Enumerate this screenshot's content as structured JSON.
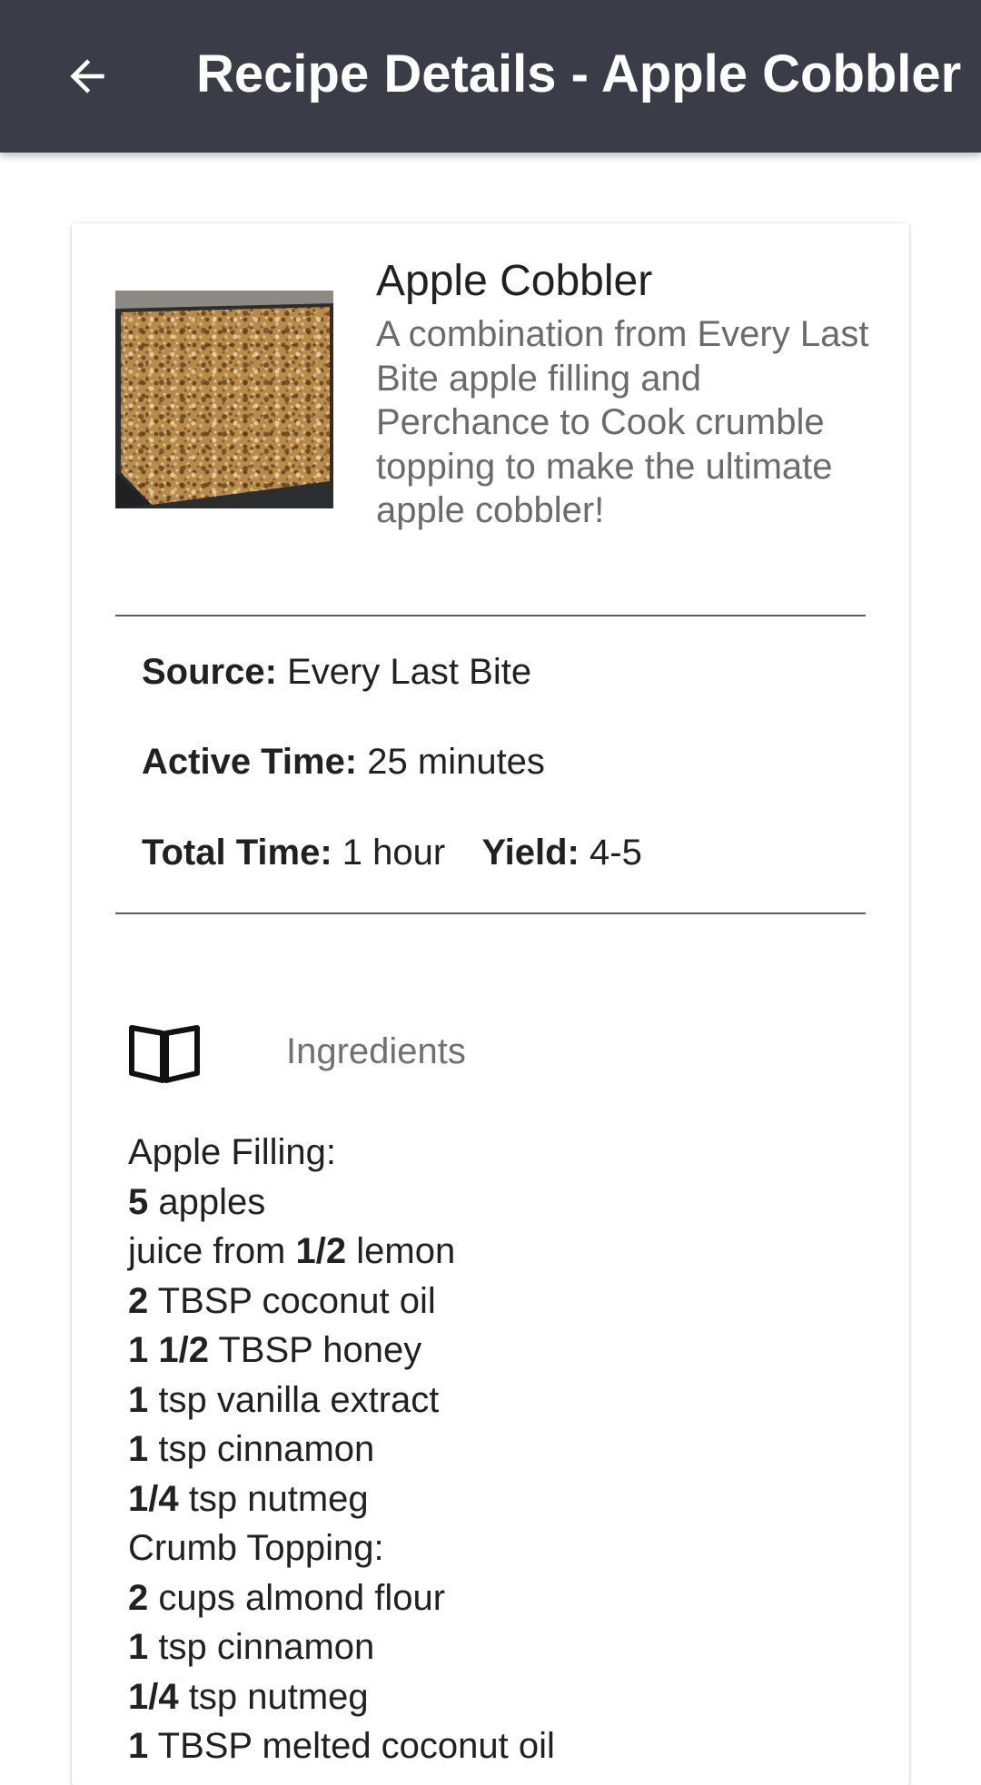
{
  "appbar": {
    "title": "Recipe Details - Apple Cobbler",
    "back_icon": "arrow-left-icon"
  },
  "recipe": {
    "name": "Apple Cobbler",
    "description": "A combination from Every Last Bite apple filling and Perchance to Cook crumble topping to make the ultimate apple cobbler!",
    "image_icon": "apple-cobbler-photo"
  },
  "meta": {
    "source_label": "Source:",
    "source_value": "Every Last Bite",
    "active_label": "Active Time:",
    "active_value": "25 minutes",
    "total_label": "Total Time:",
    "total_value": "1 hour",
    "yield_label": "Yield:",
    "yield_value": "4-5"
  },
  "ingredients_section": {
    "label": "Ingredients",
    "icon": "open-book-icon"
  },
  "ingredients": [
    {
      "qty": "",
      "text": "Apple Filling:"
    },
    {
      "qty": "5",
      "text": "apples"
    },
    {
      "prefix": "juice from",
      "qty": "1/2",
      "text": "lemon"
    },
    {
      "qty": "2",
      "text": "TBSP coconut oil"
    },
    {
      "qty": "1 1/2",
      "text": "TBSP honey"
    },
    {
      "qty": "1",
      "text": "tsp vanilla extract"
    },
    {
      "qty": "1",
      "text": "tsp cinnamon"
    },
    {
      "qty": "1/4",
      "text": "tsp nutmeg"
    },
    {
      "qty": "",
      "text": "Crumb Topping:"
    },
    {
      "qty": "2",
      "text": "cups almond flour"
    },
    {
      "qty": "1",
      "text": "tsp cinnamon"
    },
    {
      "qty": "1/4",
      "text": "tsp nutmeg"
    },
    {
      "qty": "1",
      "text": "TBSP melted coconut oil"
    }
  ],
  "colors": {
    "appbar": "#3a3d48",
    "title_text": "#ffffff",
    "description_text": "#6b6b6b",
    "section_label_text": "#707070"
  }
}
